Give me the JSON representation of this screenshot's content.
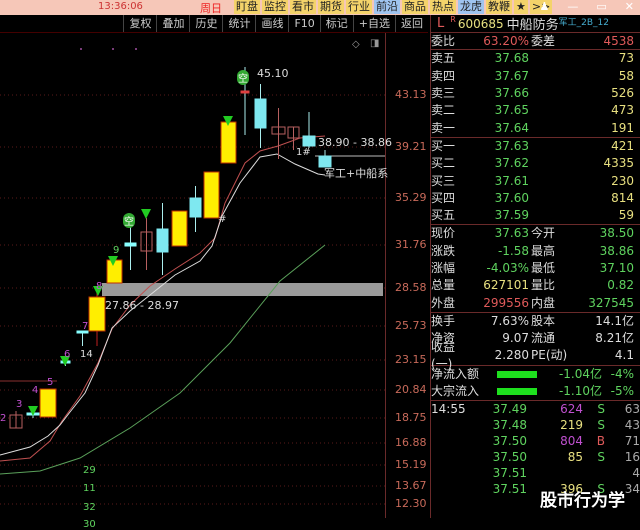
{
  "topbar": {
    "time": "13:36:06",
    "day": "周日",
    "menus": [
      "盯盘",
      "监控",
      "看市",
      "期货",
      "行业",
      "前沿",
      "商品",
      "热点",
      "龙虎",
      "教鞭",
      "★",
      ">>"
    ],
    "window_controls": [
      "♟",
      "—",
      "▭",
      "✕"
    ]
  },
  "toolbar": {
    "buttons": [
      "复权",
      "叠加",
      "历史",
      "统计",
      "画线",
      "F10",
      "标记",
      "+自选",
      "返回"
    ]
  },
  "chart": {
    "price_labels": [
      "43.13",
      "39.21",
      "35.29",
      "31.76",
      "28.58",
      "25.73",
      "23.15",
      "20.84",
      "18.75",
      "16.88",
      "15.19",
      "13.67",
      "12.30"
    ],
    "annotations": {
      "high": "45.10",
      "range_top": "38.90 - 38.86",
      "range_low": "27.86 - 28.97",
      "sector": "军工+中船系",
      "mark1": "1#",
      "mark2": "#",
      "kong": "空",
      "label_14": "14"
    },
    "counts": [
      "2",
      "3",
      "4",
      "5",
      "6",
      "7",
      "8",
      "9"
    ],
    "bottom_numbers": [
      "29",
      "11",
      "32",
      "30"
    ]
  },
  "quote": {
    "flag": "L",
    "r": "R",
    "code": "600685",
    "name": "中船防务",
    "tag": "军工_2B_12",
    "weibi_label": "委比",
    "weibi": "63.20%",
    "weicha_label": "委差",
    "weicha": "4538",
    "sell": [
      {
        "label": "卖五",
        "price": "37.68",
        "vol": "73"
      },
      {
        "label": "卖四",
        "price": "37.67",
        "vol": "58"
      },
      {
        "label": "卖三",
        "price": "37.66",
        "vol": "526"
      },
      {
        "label": "卖二",
        "price": "37.65",
        "vol": "473"
      },
      {
        "label": "卖一",
        "price": "37.64",
        "vol": "191"
      }
    ],
    "buy": [
      {
        "label": "买一",
        "price": "37.63",
        "vol": "421"
      },
      {
        "label": "买二",
        "price": "37.62",
        "vol": "4335"
      },
      {
        "label": "买三",
        "price": "37.61",
        "vol": "230"
      },
      {
        "label": "买四",
        "price": "37.60",
        "vol": "814"
      },
      {
        "label": "买五",
        "price": "37.59",
        "vol": "59"
      }
    ],
    "stats": [
      {
        "k": "现价",
        "v": "37.63",
        "k2": "今开",
        "v2": "38.50"
      },
      {
        "k": "涨跌",
        "v": "-1.58",
        "k2": "最高",
        "v2": "38.86"
      },
      {
        "k": "涨幅",
        "v": "-4.03%",
        "k2": "最低",
        "v2": "37.10"
      },
      {
        "k": "总量",
        "v": "627101",
        "k2": "量比",
        "v2": "0.82"
      },
      {
        "k": "外盘",
        "v": "299556",
        "k2": "内盘",
        "v2": "327545"
      }
    ],
    "fund": [
      {
        "k": "换手",
        "v": "7.63%",
        "k2": "股本",
        "v2": "14.1亿"
      },
      {
        "k": "净资",
        "v": "9.07",
        "k2": "流通",
        "v2": "8.21亿"
      },
      {
        "k": "收益(一)",
        "v": "2.280",
        "k2": "PE(动)",
        "v2": "4.1"
      }
    ],
    "flow": [
      {
        "k": "净流入额",
        "v": "-1.04亿",
        "pct": "-4%"
      },
      {
        "k": "大宗流入",
        "v": "-1.10亿",
        "pct": "-5%"
      }
    ],
    "ticks": [
      {
        "time": "14:55",
        "price": "37.49",
        "vol": "624",
        "bs": "S",
        "n": "63"
      },
      {
        "time": "",
        "price": "37.48",
        "vol": "219",
        "bs": "S",
        "n": "43"
      },
      {
        "time": "",
        "price": "37.50",
        "vol": "804",
        "bs": "B",
        "n": "71"
      },
      {
        "time": "",
        "price": "37.50",
        "vol": "85",
        "bs": "S",
        "n": "16"
      },
      {
        "time": "",
        "price": "37.51",
        "vol": "",
        "bs": "",
        "n": "4"
      },
      {
        "time": "",
        "price": "37.51",
        "vol": "396",
        "bs": "S",
        "n": "34"
      }
    ]
  },
  "watermark": "股市行为学"
}
